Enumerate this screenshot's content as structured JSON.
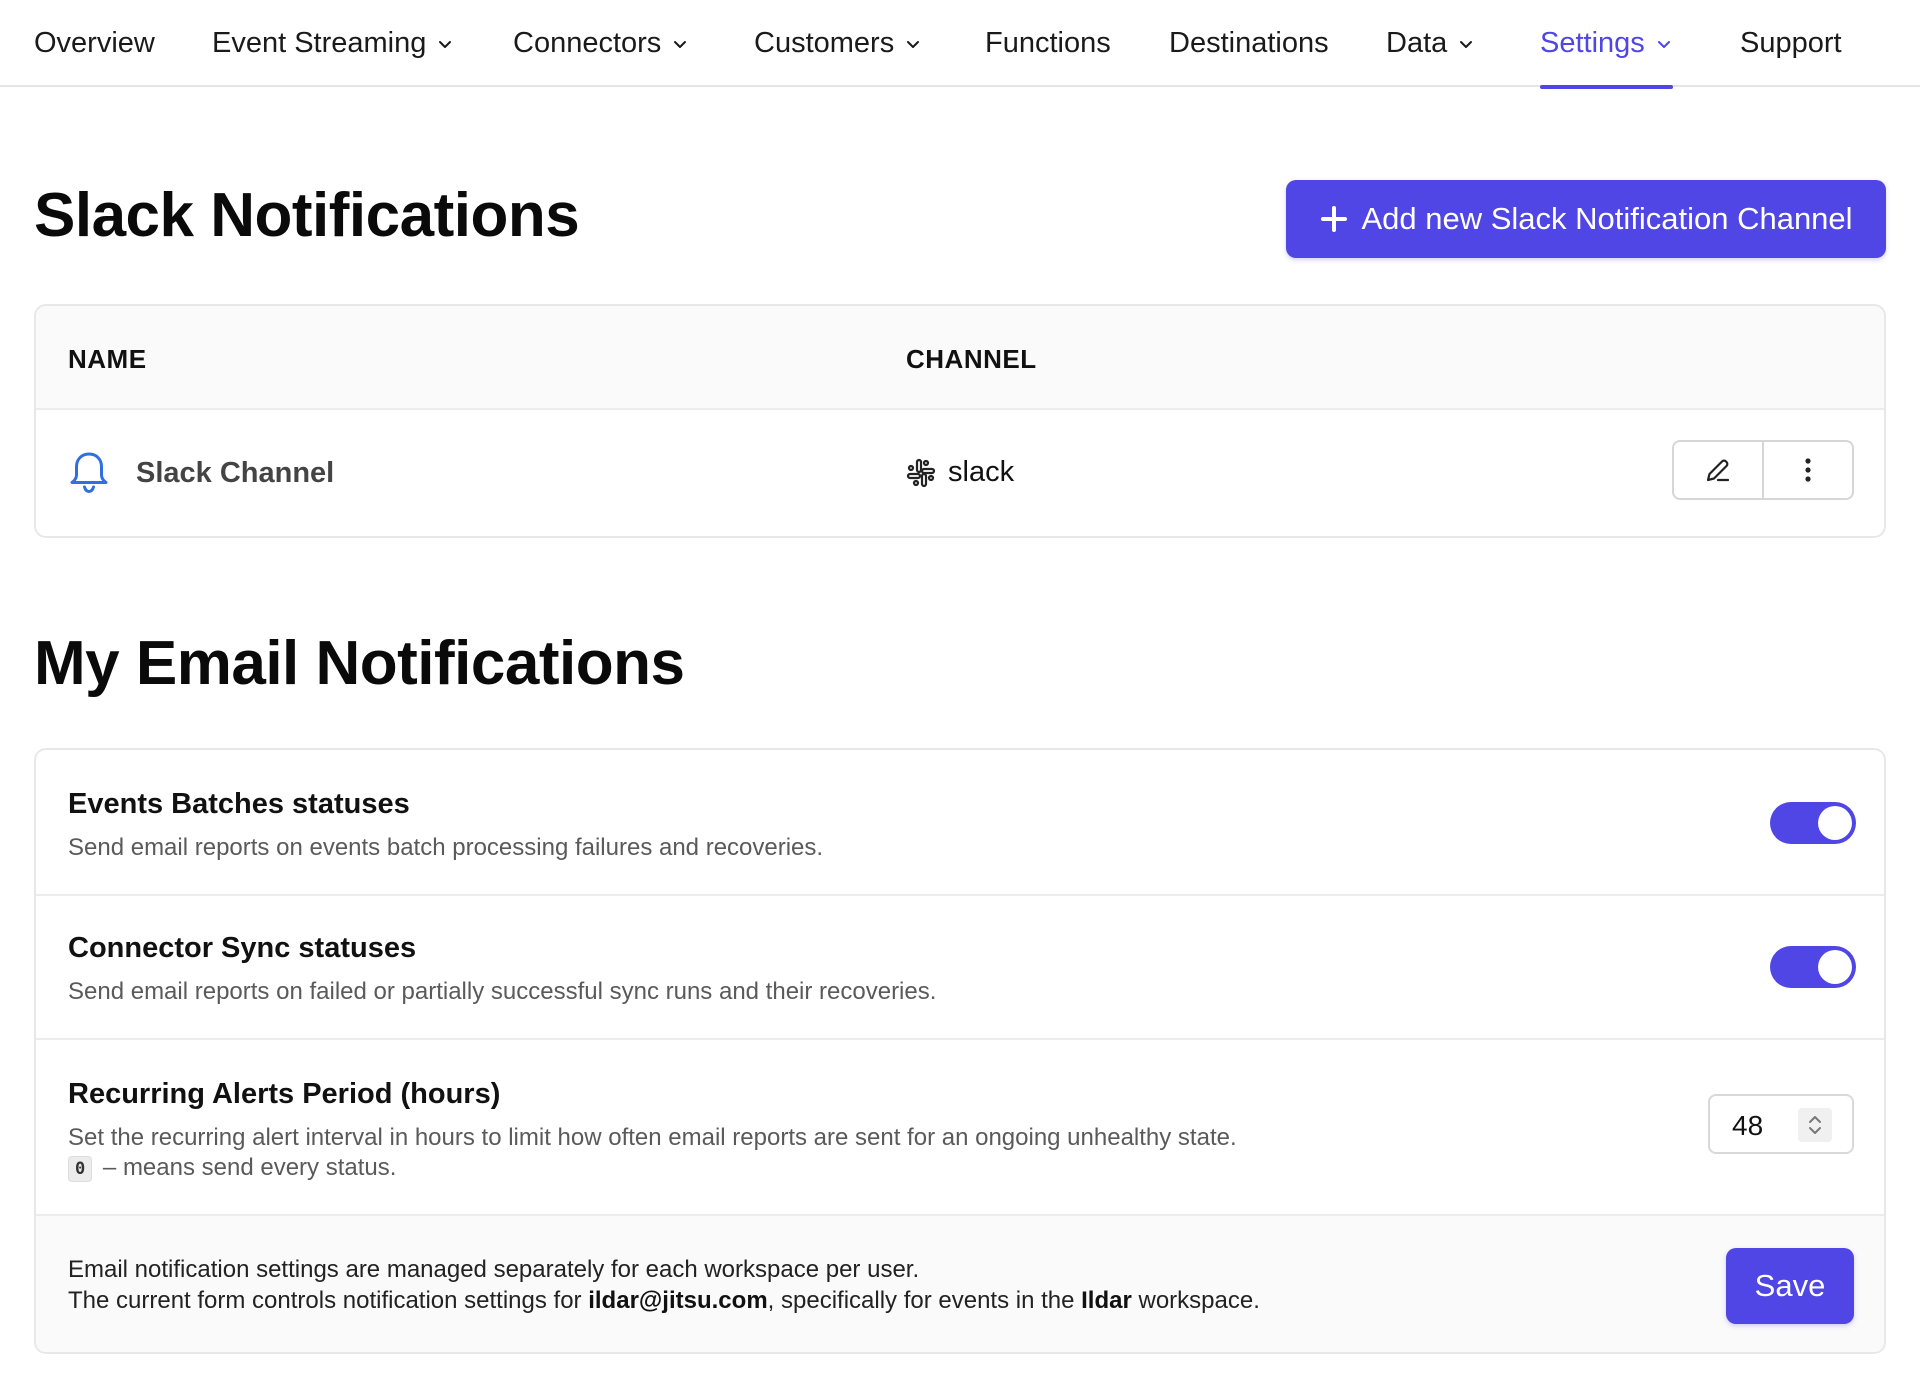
{
  "nav": {
    "items": [
      {
        "label": "Overview",
        "dropdown": false,
        "active": false
      },
      {
        "label": "Event Streaming",
        "dropdown": true,
        "active": false
      },
      {
        "label": "Connectors",
        "dropdown": true,
        "active": false
      },
      {
        "label": "Customers",
        "dropdown": true,
        "active": false
      },
      {
        "label": "Functions",
        "dropdown": false,
        "active": false
      },
      {
        "label": "Destinations",
        "dropdown": false,
        "active": false
      },
      {
        "label": "Data",
        "dropdown": true,
        "active": false
      },
      {
        "label": "Settings",
        "dropdown": true,
        "active": true
      },
      {
        "label": "Support",
        "dropdown": false,
        "active": false
      }
    ]
  },
  "slack": {
    "title": "Slack Notifications",
    "add_button_label": "Add new Slack Notification Channel",
    "columns": {
      "name": "NAME",
      "channel": "CHANNEL"
    },
    "rows": [
      {
        "name": "Slack Channel",
        "channel": "slack"
      }
    ]
  },
  "email": {
    "title": "My Email Notifications",
    "events_batches": {
      "title": "Events Batches statuses",
      "description": "Send email reports on events batch processing failures and recoveries.",
      "enabled": true
    },
    "connector_sync": {
      "title": "Connector Sync statuses",
      "description": "Send email reports on failed or partially successful sync runs and their recoveries.",
      "enabled": true
    },
    "recurring": {
      "title": "Recurring Alerts Period (hours)",
      "description": "Set the recurring alert interval in hours to limit how often email reports are sent for an ongoing unhealthy state.",
      "zero_code": "0",
      "zero_note": "– means send every status.",
      "value": "48"
    },
    "footer": {
      "line1": "Email notification settings are managed separately for each workspace per user.",
      "line2_prefix": "The current form controls notification settings for ",
      "email": "ildar@jitsu.com",
      "line2_middle": ", specifically for events in the ",
      "workspace": "Ildar",
      "line2_suffix": " workspace."
    },
    "save_label": "Save"
  },
  "colors": {
    "accent": "#4f46e5",
    "bell_icon": "#2f6fe0"
  }
}
